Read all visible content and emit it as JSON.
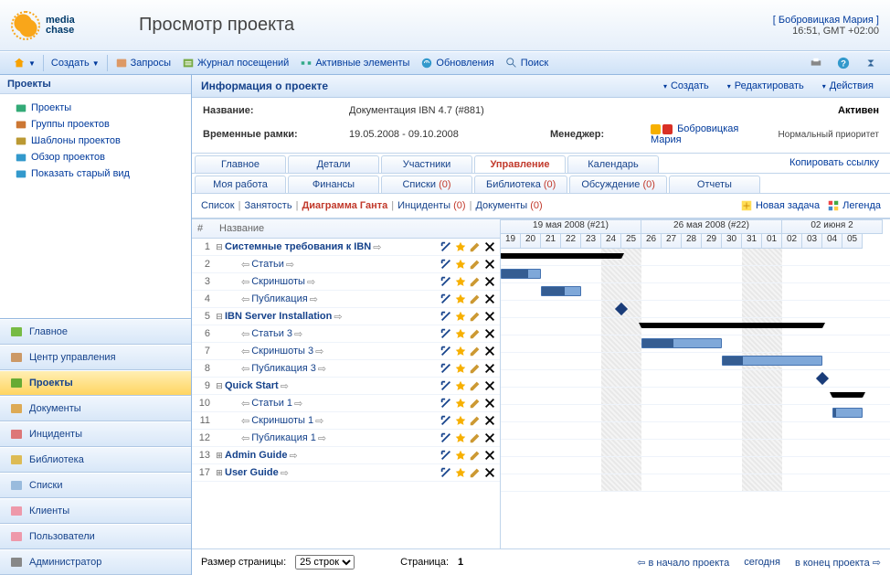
{
  "logo": {
    "line1": "media",
    "line2": "chase"
  },
  "page_title": "Просмотр проекта",
  "user": {
    "name": "[ Бобровицкая Мария ]",
    "time": "16:51, GMT +02:00"
  },
  "toolbar": {
    "create": "Создать",
    "requests": "Запросы",
    "journal": "Журнал посещений",
    "active": "Активные элементы",
    "updates": "Обновления",
    "search": "Поиск"
  },
  "left": {
    "title": "Проекты",
    "items": [
      {
        "name": "Проекты"
      },
      {
        "name": "Группы проектов"
      },
      {
        "name": "Шаблоны проектов"
      },
      {
        "name": "Обзор проектов"
      },
      {
        "name": "Показать старый вид"
      }
    ],
    "nav": [
      {
        "name": "Главное"
      },
      {
        "name": "Центр управления"
      },
      {
        "name": "Проекты",
        "selected": true
      },
      {
        "name": "Документы"
      },
      {
        "name": "Инциденты"
      },
      {
        "name": "Библиотека"
      },
      {
        "name": "Списки"
      },
      {
        "name": "Клиенты"
      },
      {
        "name": "Пользователи"
      },
      {
        "name": "Администратор"
      }
    ]
  },
  "panel": {
    "title": "Информация о проекте",
    "actions": {
      "create": "Создать",
      "edit": "Редактировать",
      "actions": "Действия"
    }
  },
  "info": {
    "name_lbl": "Название:",
    "name_val": "Документация IBN 4.7 (#881)",
    "status": "Активен",
    "time_lbl": "Временные рамки:",
    "time_val": "19.05.2008 - 09.10.2008",
    "mgr_lbl": "Менеджер:",
    "mgr_val": "Бобровицкая Мария",
    "priority": "Нормальный приоритет"
  },
  "tabs": {
    "r1": [
      {
        "label": "Главное"
      },
      {
        "label": "Детали"
      },
      {
        "label": "Участники"
      },
      {
        "label": "Управление",
        "selected": true
      },
      {
        "label": "Календарь"
      }
    ],
    "copy": "Копировать ссылку",
    "r2": [
      {
        "label": "Моя работа"
      },
      {
        "label": "Финансы"
      },
      {
        "label": "Списки",
        "count": "(0)"
      },
      {
        "label": "Библиотека",
        "count": "(0)"
      },
      {
        "label": "Обсуждение",
        "count": "(0)"
      },
      {
        "label": "Отчеты"
      }
    ]
  },
  "subtabs": {
    "items": [
      {
        "label": "Список"
      },
      {
        "label": "Занятость"
      },
      {
        "label": "Диаграмма Ганта",
        "selected": true
      },
      {
        "label": "Инциденты",
        "count": "(0)"
      },
      {
        "label": "Документы",
        "count": "(0)"
      }
    ],
    "newtask": "Новая задача",
    "legend": "Легенда"
  },
  "gantt": {
    "head": {
      "num": "#",
      "name": "Название"
    },
    "weeks": [
      {
        "label": "19 мая 2008 (#21)",
        "days": 7
      },
      {
        "label": "26 мая 2008 (#22)",
        "days": 7
      },
      {
        "label": "02 июня 2",
        "days": 5
      }
    ],
    "days": [
      "19",
      "20",
      "21",
      "22",
      "23",
      "24",
      "25",
      "26",
      "27",
      "28",
      "29",
      "30",
      "31",
      "01",
      "02",
      "03",
      "04",
      "05"
    ],
    "rows": [
      {
        "n": 1,
        "name": "Системные требования к IBN",
        "level": 0,
        "bold": true,
        "exp": "-",
        "bar": {
          "type": "summary",
          "from": 0,
          "to": 6
        }
      },
      {
        "n": 2,
        "name": "Статьи",
        "level": 1,
        "bar": {
          "type": "task",
          "from": 0,
          "to": 2,
          "prog": 70
        }
      },
      {
        "n": 3,
        "name": "Скриншоты",
        "level": 1,
        "bar": {
          "type": "task",
          "from": 2,
          "to": 4,
          "prog": 60
        }
      },
      {
        "n": 4,
        "name": "Публикация",
        "level": 1,
        "diamond": 6
      },
      {
        "n": 5,
        "name": "IBN Server Installation",
        "level": 0,
        "bold": true,
        "exp": "-",
        "bar": {
          "type": "summary",
          "from": 7,
          "to": 16
        }
      },
      {
        "n": 6,
        "name": "Статьи 3",
        "level": 1,
        "bar": {
          "type": "task",
          "from": 7,
          "to": 11,
          "prog": 40
        }
      },
      {
        "n": 7,
        "name": "Скриншоты 3",
        "level": 1,
        "bar": {
          "type": "task",
          "from": 11,
          "to": 16,
          "prog": 20
        }
      },
      {
        "n": 8,
        "name": "Публикация 3",
        "level": 1,
        "diamond": 16
      },
      {
        "n": 9,
        "name": "Quick Start",
        "level": 0,
        "bold": true,
        "exp": "-",
        "bar": {
          "type": "summary",
          "from": 16.5,
          "to": 18
        }
      },
      {
        "n": 10,
        "name": "Статьи 1",
        "level": 1,
        "bar": {
          "type": "task",
          "from": 16.5,
          "to": 18,
          "prog": 10
        }
      },
      {
        "n": 11,
        "name": "Скриншоты 1",
        "level": 1
      },
      {
        "n": 12,
        "name": "Публикация 1",
        "level": 1
      },
      {
        "n": 13,
        "name": "Admin Guide",
        "level": 0,
        "bold": true,
        "exp": "+"
      },
      {
        "n": 17,
        "name": "User Guide",
        "level": 0,
        "bold": true,
        "exp": "+"
      }
    ]
  },
  "pager": {
    "size_lbl": "Размер страницы:",
    "size_val": "25 строк",
    "page_lbl": "Страница:",
    "page_val": "1",
    "start": "в начало проекта",
    "today": "сегодня",
    "end": "в конец проекта"
  }
}
